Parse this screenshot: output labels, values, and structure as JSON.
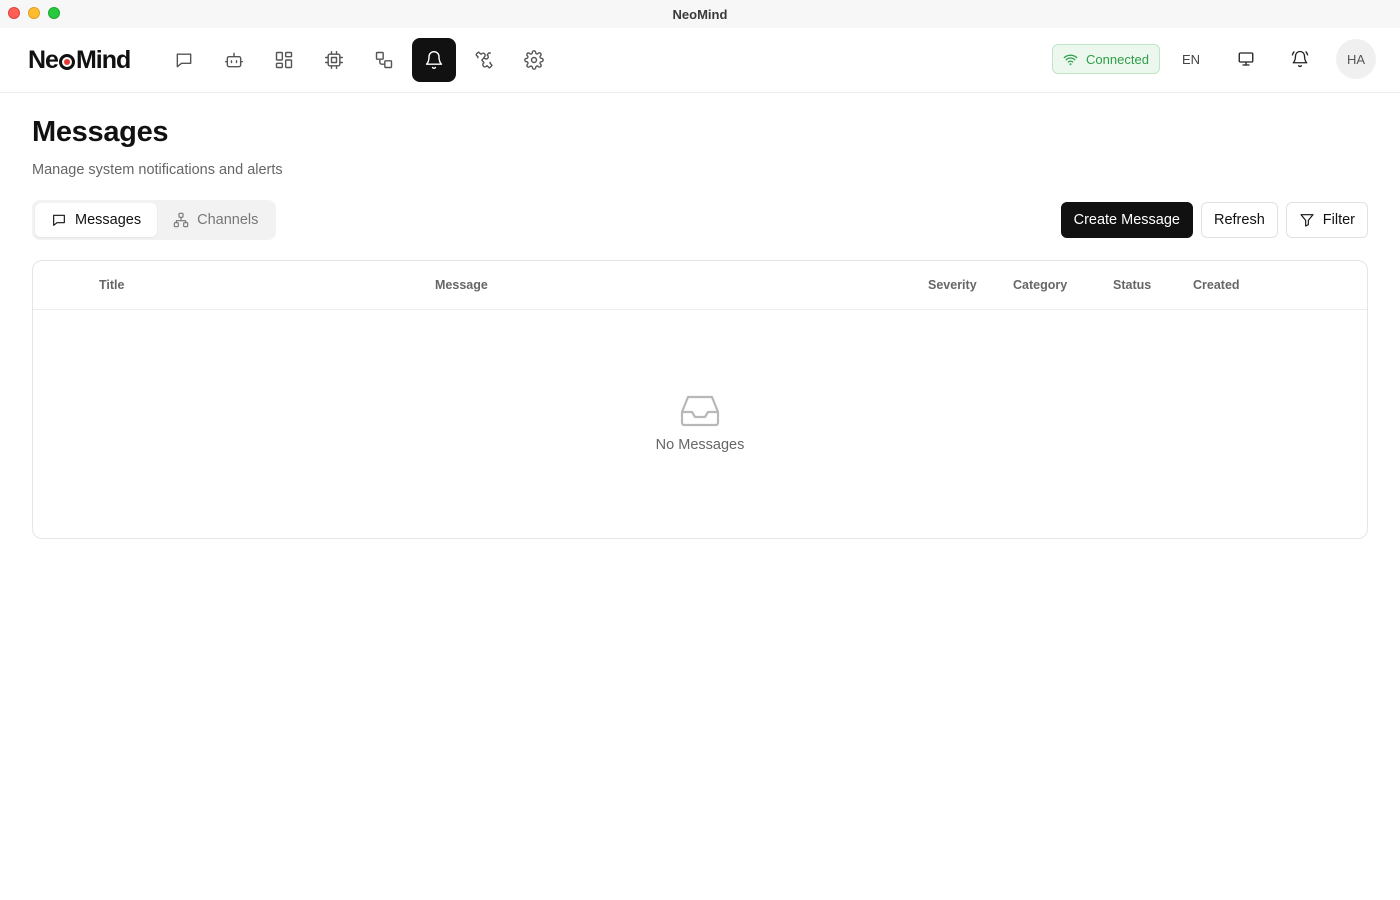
{
  "window": {
    "title": "NeoMind"
  },
  "header": {
    "logo_text_1": "Ne",
    "logo_text_2": "Mind",
    "nav": [
      {
        "name": "chat-icon"
      },
      {
        "name": "agent-icon"
      },
      {
        "name": "dashboard-icon"
      },
      {
        "name": "device-icon"
      },
      {
        "name": "automation-icon"
      },
      {
        "name": "bell-icon",
        "active": true
      },
      {
        "name": "puzzle-icon"
      },
      {
        "name": "gear-icon"
      }
    ],
    "status": "Connected",
    "language": "EN",
    "avatar": "HA"
  },
  "page": {
    "title": "Messages",
    "subtitle": "Manage system notifications and alerts"
  },
  "tabs": [
    {
      "label": "Messages",
      "active": true
    },
    {
      "label": "Channels",
      "active": false
    }
  ],
  "actions": {
    "create": "Create Message",
    "refresh": "Refresh",
    "filter": "Filter"
  },
  "table": {
    "columns": [
      "Title",
      "Message",
      "Severity",
      "Category",
      "Status",
      "Created"
    ],
    "rows": [],
    "empty_text": "No Messages"
  },
  "colors": {
    "accent": "#111111",
    "status_bg": "#ecf8ee",
    "status_text": "#2e9e48"
  }
}
